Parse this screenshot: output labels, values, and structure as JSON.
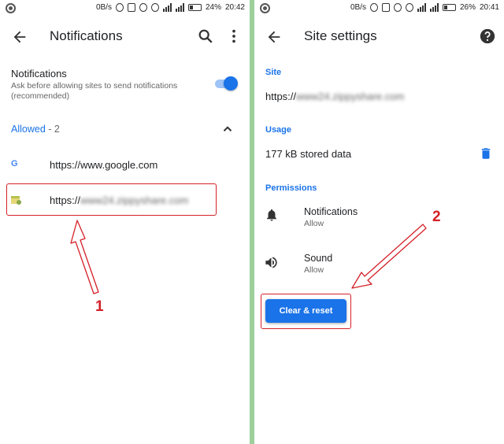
{
  "left": {
    "status": {
      "speed": "0B/s",
      "battery": "24%",
      "time": "20:42"
    },
    "title": "Notifications",
    "setting": {
      "title": "Notifications",
      "description_line1": "Ask before allowing sites to send notifications",
      "description_line2": "(recommended)",
      "enabled": true
    },
    "allowed": {
      "label": "Allowed",
      "count": " - 2"
    },
    "sites": [
      {
        "favicon": "G",
        "url": "https://www.google.com"
      },
      {
        "url_prefix": "https://",
        "url_blurred": "www24.zippyshare.com"
      }
    ],
    "annotation": "1"
  },
  "right": {
    "status": {
      "speed": "0B/s",
      "battery": "26%",
      "time": "20:41"
    },
    "title": "Site settings",
    "site_head": "Site",
    "site_url_prefix": "https://",
    "site_url_blurred": "www24.zippyshare.com",
    "usage_head": "Usage",
    "usage_text": "177 kB stored data",
    "permissions_head": "Permissions",
    "permissions": [
      {
        "name": "Notifications",
        "value": "Allow",
        "icon": "bell-icon"
      },
      {
        "name": "Sound",
        "value": "Allow",
        "icon": "speaker-icon"
      }
    ],
    "button": "Clear & reset",
    "annotation": "2"
  },
  "colors": {
    "accent": "#1a73e8",
    "annotation": "#d42027",
    "divider": "#9ccf9a"
  }
}
